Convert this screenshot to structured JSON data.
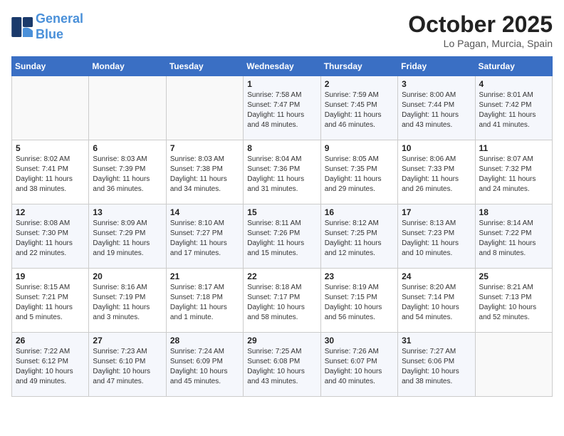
{
  "header": {
    "logo_line1": "General",
    "logo_line2": "Blue",
    "month_title": "October 2025",
    "location": "Lo Pagan, Murcia, Spain"
  },
  "days_of_week": [
    "Sunday",
    "Monday",
    "Tuesday",
    "Wednesday",
    "Thursday",
    "Friday",
    "Saturday"
  ],
  "weeks": [
    [
      {
        "num": "",
        "info": ""
      },
      {
        "num": "",
        "info": ""
      },
      {
        "num": "",
        "info": ""
      },
      {
        "num": "1",
        "info": "Sunrise: 7:58 AM\nSunset: 7:47 PM\nDaylight: 11 hours and 48 minutes."
      },
      {
        "num": "2",
        "info": "Sunrise: 7:59 AM\nSunset: 7:45 PM\nDaylight: 11 hours and 46 minutes."
      },
      {
        "num": "3",
        "info": "Sunrise: 8:00 AM\nSunset: 7:44 PM\nDaylight: 11 hours and 43 minutes."
      },
      {
        "num": "4",
        "info": "Sunrise: 8:01 AM\nSunset: 7:42 PM\nDaylight: 11 hours and 41 minutes."
      }
    ],
    [
      {
        "num": "5",
        "info": "Sunrise: 8:02 AM\nSunset: 7:41 PM\nDaylight: 11 hours and 38 minutes."
      },
      {
        "num": "6",
        "info": "Sunrise: 8:03 AM\nSunset: 7:39 PM\nDaylight: 11 hours and 36 minutes."
      },
      {
        "num": "7",
        "info": "Sunrise: 8:03 AM\nSunset: 7:38 PM\nDaylight: 11 hours and 34 minutes."
      },
      {
        "num": "8",
        "info": "Sunrise: 8:04 AM\nSunset: 7:36 PM\nDaylight: 11 hours and 31 minutes."
      },
      {
        "num": "9",
        "info": "Sunrise: 8:05 AM\nSunset: 7:35 PM\nDaylight: 11 hours and 29 minutes."
      },
      {
        "num": "10",
        "info": "Sunrise: 8:06 AM\nSunset: 7:33 PM\nDaylight: 11 hours and 26 minutes."
      },
      {
        "num": "11",
        "info": "Sunrise: 8:07 AM\nSunset: 7:32 PM\nDaylight: 11 hours and 24 minutes."
      }
    ],
    [
      {
        "num": "12",
        "info": "Sunrise: 8:08 AM\nSunset: 7:30 PM\nDaylight: 11 hours and 22 minutes."
      },
      {
        "num": "13",
        "info": "Sunrise: 8:09 AM\nSunset: 7:29 PM\nDaylight: 11 hours and 19 minutes."
      },
      {
        "num": "14",
        "info": "Sunrise: 8:10 AM\nSunset: 7:27 PM\nDaylight: 11 hours and 17 minutes."
      },
      {
        "num": "15",
        "info": "Sunrise: 8:11 AM\nSunset: 7:26 PM\nDaylight: 11 hours and 15 minutes."
      },
      {
        "num": "16",
        "info": "Sunrise: 8:12 AM\nSunset: 7:25 PM\nDaylight: 11 hours and 12 minutes."
      },
      {
        "num": "17",
        "info": "Sunrise: 8:13 AM\nSunset: 7:23 PM\nDaylight: 11 hours and 10 minutes."
      },
      {
        "num": "18",
        "info": "Sunrise: 8:14 AM\nSunset: 7:22 PM\nDaylight: 11 hours and 8 minutes."
      }
    ],
    [
      {
        "num": "19",
        "info": "Sunrise: 8:15 AM\nSunset: 7:21 PM\nDaylight: 11 hours and 5 minutes."
      },
      {
        "num": "20",
        "info": "Sunrise: 8:16 AM\nSunset: 7:19 PM\nDaylight: 11 hours and 3 minutes."
      },
      {
        "num": "21",
        "info": "Sunrise: 8:17 AM\nSunset: 7:18 PM\nDaylight: 11 hours and 1 minute."
      },
      {
        "num": "22",
        "info": "Sunrise: 8:18 AM\nSunset: 7:17 PM\nDaylight: 10 hours and 58 minutes."
      },
      {
        "num": "23",
        "info": "Sunrise: 8:19 AM\nSunset: 7:15 PM\nDaylight: 10 hours and 56 minutes."
      },
      {
        "num": "24",
        "info": "Sunrise: 8:20 AM\nSunset: 7:14 PM\nDaylight: 10 hours and 54 minutes."
      },
      {
        "num": "25",
        "info": "Sunrise: 8:21 AM\nSunset: 7:13 PM\nDaylight: 10 hours and 52 minutes."
      }
    ],
    [
      {
        "num": "26",
        "info": "Sunrise: 7:22 AM\nSunset: 6:12 PM\nDaylight: 10 hours and 49 minutes."
      },
      {
        "num": "27",
        "info": "Sunrise: 7:23 AM\nSunset: 6:10 PM\nDaylight: 10 hours and 47 minutes."
      },
      {
        "num": "28",
        "info": "Sunrise: 7:24 AM\nSunset: 6:09 PM\nDaylight: 10 hours and 45 minutes."
      },
      {
        "num": "29",
        "info": "Sunrise: 7:25 AM\nSunset: 6:08 PM\nDaylight: 10 hours and 43 minutes."
      },
      {
        "num": "30",
        "info": "Sunrise: 7:26 AM\nSunset: 6:07 PM\nDaylight: 10 hours and 40 minutes."
      },
      {
        "num": "31",
        "info": "Sunrise: 7:27 AM\nSunset: 6:06 PM\nDaylight: 10 hours and 38 minutes."
      },
      {
        "num": "",
        "info": ""
      }
    ]
  ]
}
